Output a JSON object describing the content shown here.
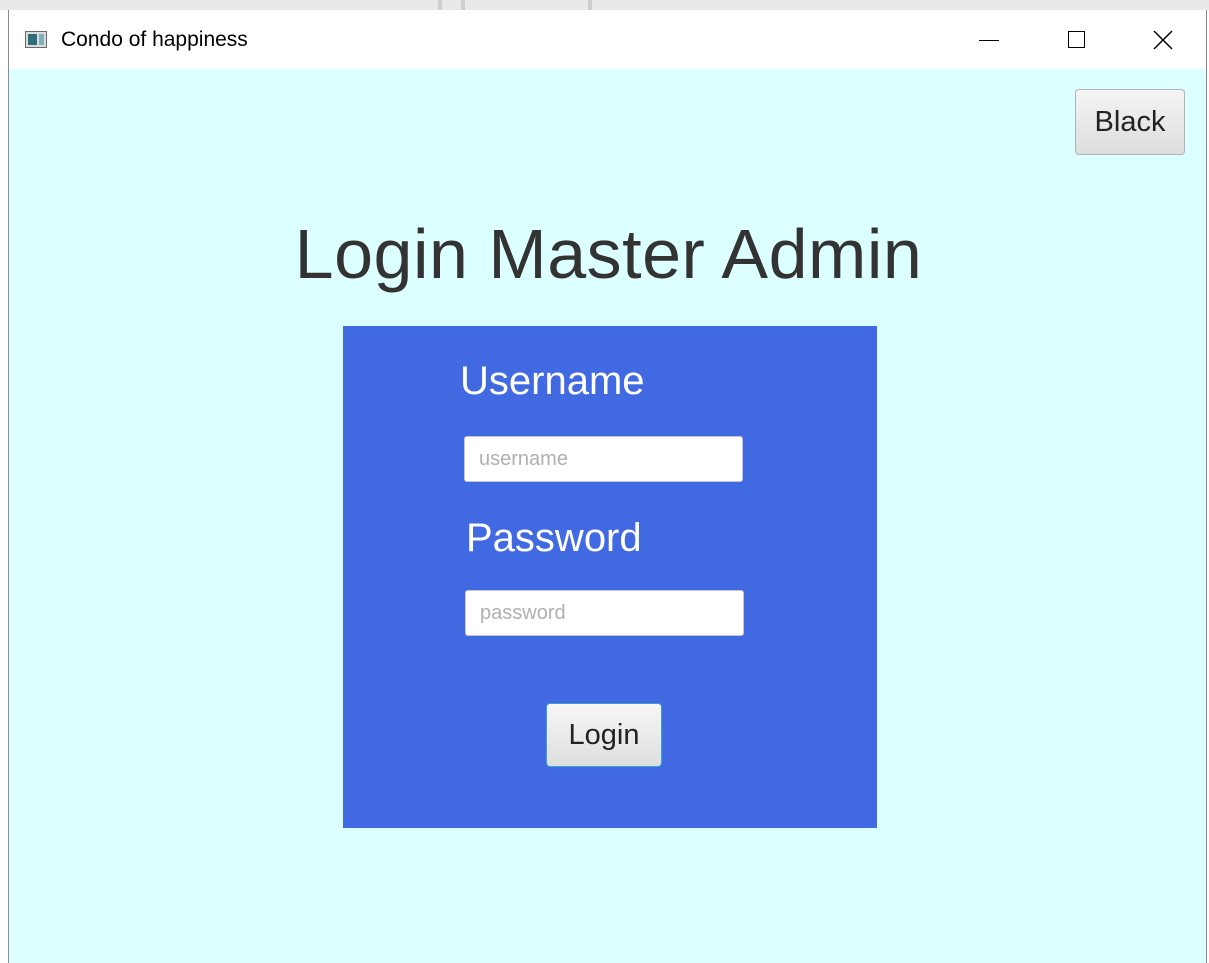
{
  "window": {
    "title": "Condo of happiness",
    "controls": {
      "minimize": "minimize-icon",
      "maximize": "maximize-icon",
      "close": "close-icon"
    }
  },
  "header": {
    "back_label": "Black"
  },
  "main": {
    "title": "Login Master Admin",
    "form": {
      "username_label": "Username",
      "username_value": "",
      "username_placeholder": "username",
      "password_label": "Password",
      "password_value": "",
      "password_placeholder": "password",
      "login_label": "Login"
    }
  },
  "colors": {
    "background": "#dcffff",
    "panel": "#4169e1",
    "title_text": "#333333",
    "label_text": "#ffffff"
  }
}
